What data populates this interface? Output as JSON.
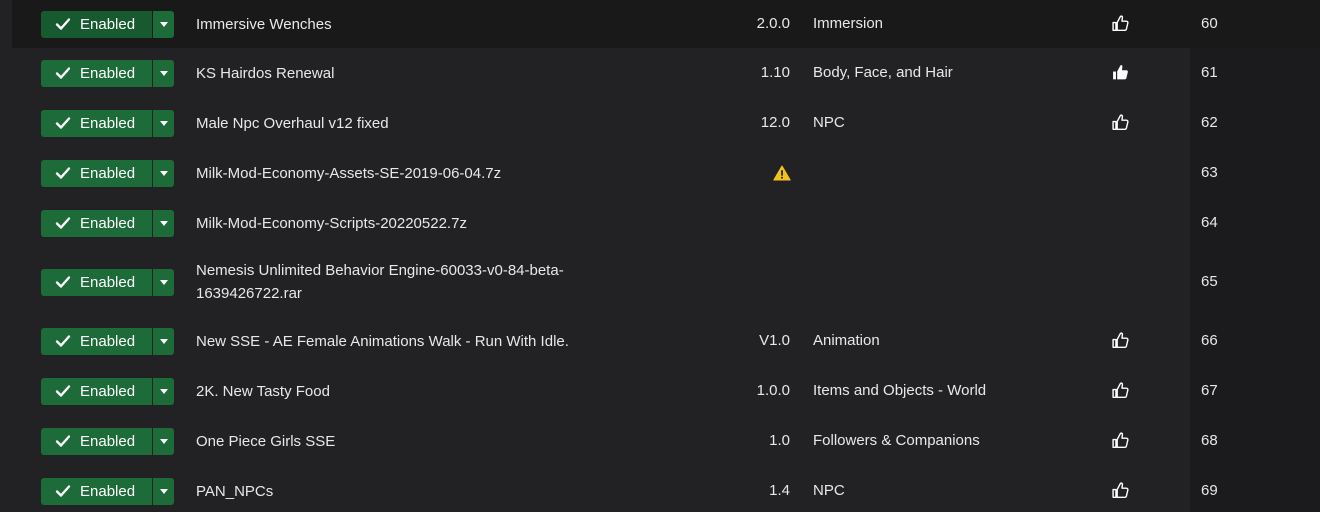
{
  "mods": [
    {
      "status": "Enabled",
      "name": "Immersive Wenches",
      "version": "2.0.0",
      "category": "Immersion",
      "endorse": "outline",
      "order": "60",
      "warning": false,
      "highlight": true
    },
    {
      "status": "Enabled",
      "name": "KS Hairdos Renewal",
      "version": "1.10",
      "category": "Body, Face, and Hair",
      "endorse": "filled",
      "order": "61",
      "warning": false,
      "highlight": false
    },
    {
      "status": "Enabled",
      "name": "Male Npc Overhaul v12 fixed",
      "version": "12.0",
      "category": "NPC",
      "endorse": "outline",
      "order": "62",
      "warning": false,
      "highlight": false
    },
    {
      "status": "Enabled",
      "name": "Milk-Mod-Economy-Assets-SE-2019-06-04.7z",
      "version": "",
      "category": "",
      "endorse": "none",
      "order": "63",
      "warning": true,
      "highlight": false
    },
    {
      "status": "Enabled",
      "name": "Milk-Mod-Economy-Scripts-20220522.7z",
      "version": "",
      "category": "",
      "endorse": "none",
      "order": "64",
      "warning": false,
      "highlight": false
    },
    {
      "status": "Enabled",
      "name": "Nemesis Unlimited Behavior Engine-60033-v0-84-beta-1639426722.rar",
      "version": "",
      "category": "",
      "endorse": "none",
      "order": "65",
      "warning": false,
      "highlight": false
    },
    {
      "status": "Enabled",
      "name": "New SSE - AE Female Animations Walk - Run With Idle.",
      "version": "V1.0",
      "category": "Animation",
      "endorse": "outline",
      "order": "66",
      "warning": false,
      "highlight": false
    },
    {
      "status": "Enabled",
      "name": "2K. New Tasty Food",
      "version": "1.0.0",
      "category": "Items and Objects - World",
      "endorse": "outline",
      "order": "67",
      "warning": false,
      "highlight": false
    },
    {
      "status": "Enabled",
      "name": "One Piece Girls SSE",
      "version": "1.0",
      "category": "Followers & Companions",
      "endorse": "outline",
      "order": "68",
      "warning": false,
      "highlight": false
    },
    {
      "status": "Enabled",
      "name": "PAN_NPCs",
      "version": "1.4",
      "category": "NPC",
      "endorse": "outline",
      "order": "69",
      "warning": false,
      "highlight": false
    }
  ],
  "colors": {
    "enabled_green": "#1c6b38",
    "warning_yellow": "#f2c21b",
    "background": "#222224"
  }
}
